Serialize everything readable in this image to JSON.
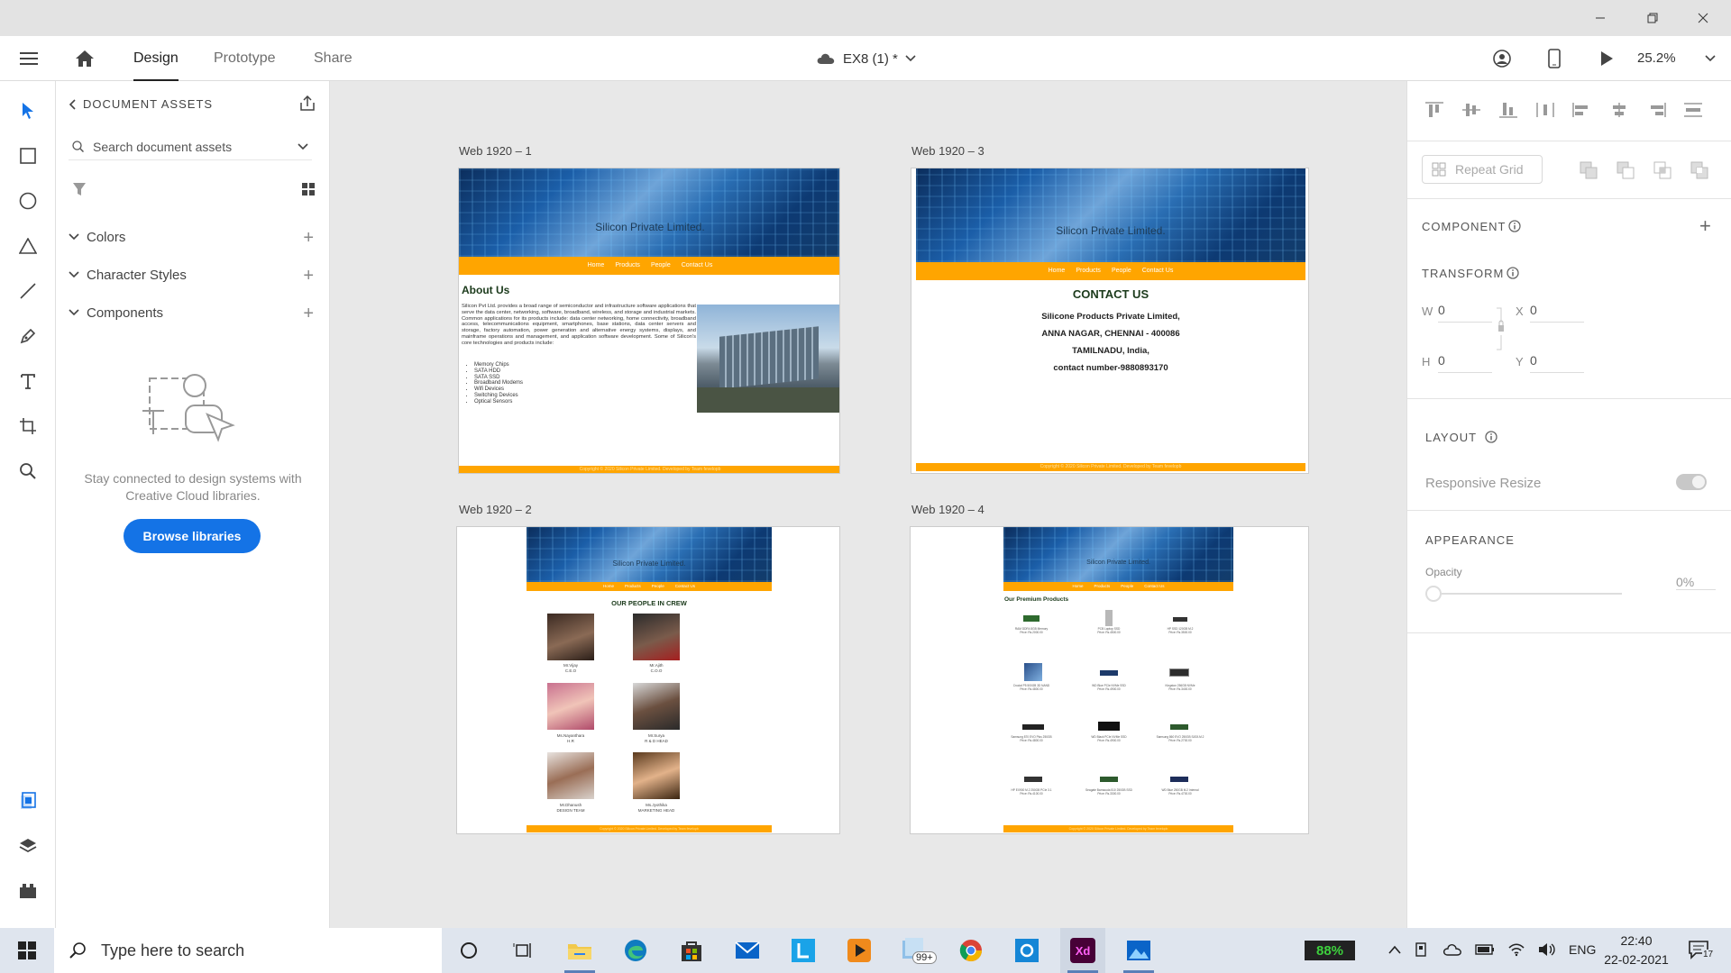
{
  "toolbar": {
    "tabs": [
      "Design",
      "Prototype",
      "Share"
    ],
    "doc_name": "EX8 (1) *",
    "zoom": "25.2%"
  },
  "assets": {
    "title": "DOCUMENT ASSETS",
    "search_placeholder": "Search document assets",
    "sections": [
      "Colors",
      "Character Styles",
      "Components"
    ],
    "empty_text": "Stay connected to design systems with Creative Cloud libraries.",
    "browse_label": "Browse libraries"
  },
  "artboards": {
    "a1": {
      "label": "Web 1920 – 1",
      "banner_title": "Silicon Private Limited.",
      "nav": [
        "Home",
        "Products",
        "People",
        "Contact Us"
      ],
      "heading": "About Us",
      "body": "Silicon Pvt Ltd. provides a broad range of semiconductor and infrastructure software applications that serve the data center, networking, software, broadband, wireless, and storage and industrial markets. Common applications for its products include: data center networking, home connectivity, broadband access, telecommunications equipment, smartphones, base stations, data center servers and storage, factory automation, power generation and alternative energy systems, displays, and mainframe operations and management, and application software development. Some of Silicon's core technologies and products include:",
      "list": [
        "Memory Chips",
        "SATA HDD",
        "SATA SSD",
        "Broadband Modems",
        "Wifi Devices",
        "Switching Devices",
        "Optical Sensors"
      ],
      "footer": "Copyright © 2020 Silicon Private Limited. Developed by Team fevelopb"
    },
    "a3": {
      "label": "Web 1920 – 3",
      "banner_title": "Silicon Private Limited.",
      "nav": [
        "Home",
        "Products",
        "People",
        "Contact Us"
      ],
      "heading": "CONTACT US",
      "lines": [
        "Silicone Products Private Limited,",
        "ANNA NAGAR, CHENNAI - 400086",
        "TAMILNADU, India,",
        "contact number-9880893170"
      ],
      "footer": "Copyright © 2020 Silicon Private Limited. Developed by Team fevelopb"
    },
    "a2": {
      "label": "Web 1920 – 2",
      "banner_title": "Silicon Private Limited.",
      "nav": [
        "Home",
        "Products",
        "People",
        "Contact Us"
      ],
      "heading": "OUR PEOPLE IN CREW",
      "people": [
        {
          "name": "Mr.Vijay",
          "role": "C.E.O"
        },
        {
          "name": "Mr.Ajith",
          "role": "C.O.O"
        },
        {
          "name": "Ms.Nayanthara",
          "role": "H.R"
        },
        {
          "name": "Mr.Surya",
          "role": "R & D HEAD"
        },
        {
          "name": "Mr.Dhanush",
          "role": "DESIGN TEAM"
        },
        {
          "name": "Ms.Jyothika",
          "role": "MARKETING HEAD"
        }
      ],
      "footer": "Copyright © 2020 Silicon Private Limited. Developed by Team fevelopb"
    },
    "a4": {
      "label": "Web 1920 – 4",
      "banner_title": "Silicon Private Limited.",
      "nav": [
        "Home",
        "Products",
        "People",
        "Contact Us"
      ],
      "heading": "Our Premium Products",
      "products": [
        {
          "name": "RAM DDR4 8GB Memory",
          "price": "Price: Rs.2000.00"
        },
        {
          "name": "PCB Laptop SSD",
          "price": "Price: Rs.4500.00"
        },
        {
          "name": "HP SSD 120GB M.2",
          "price": "Price: Rs.3500.00"
        },
        {
          "name": "Crucial P5 500GB 3D NAND",
          "price": "Price: Rs.4800.00"
        },
        {
          "name": "WD Blue PCIe NVMe SSD",
          "price": "Price: Rs.4900.00"
        },
        {
          "name": "Kingston 256GB NVMe",
          "price": "Price: Rs.3400.00"
        },
        {
          "name": "Samsung 870 EVO Plus 250GB",
          "price": "Price: Rs.4800.00"
        },
        {
          "name": "WD Black PCIe NVMe SSD",
          "price": "Price: Rs.4900.00"
        },
        {
          "name": "Samsung 860 EVO 250GB SATA M.2",
          "price": "Price: Rs.2700.00"
        },
        {
          "name": "HP EX900 M.2 250GB PCIe 3.1",
          "price": "Price: Rs.4100.00"
        },
        {
          "name": "Seagate Barracuda 510 250GB SSD",
          "price": "Price: Rs.3300.00"
        },
        {
          "name": "WD Blue 250GB M.2 Internal",
          "price": "Price: Rs.4700.00"
        }
      ],
      "footer": "Copyright © 2020 Silicon Private Limited. Developed by Team fevelopb"
    }
  },
  "props": {
    "repeat_grid": "Repeat Grid",
    "component_title": "COMPONENT",
    "transform_title": "TRANSFORM",
    "w_label": "W",
    "w_value": "0",
    "x_label": "X",
    "x_value": "0",
    "h_label": "H",
    "h_value": "0",
    "y_label": "Y",
    "y_value": "0",
    "layout_title": "LAYOUT",
    "responsive_label": "Responsive Resize",
    "appearance_title": "APPEARANCE",
    "opacity_label": "Opacity",
    "opacity_value": "0%",
    "opacity_fraction": 0
  },
  "taskbar": {
    "search_placeholder": "Type here to search",
    "badge": "99+",
    "battery": "88%",
    "lang": "ENG",
    "time": "22:40",
    "date": "22-02-2021",
    "notif_count": "17"
  },
  "colors": {
    "accent_blue": "#1473e6",
    "orange": "#ffa500",
    "xd_purple": "#470137"
  }
}
